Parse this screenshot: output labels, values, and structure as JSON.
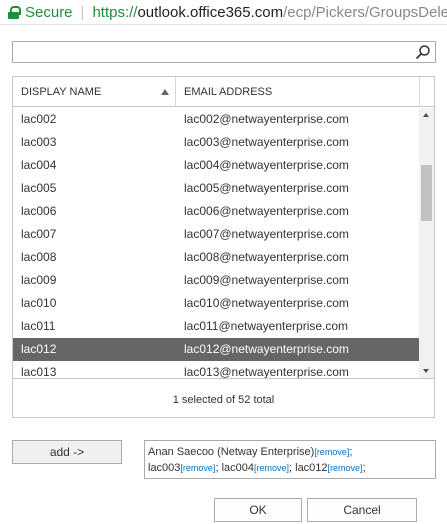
{
  "address_bar": {
    "secure_label": "Secure",
    "scheme": "https://",
    "host": "outlook.office365.com",
    "path": "/ecp/Pickers/GroupsDelega"
  },
  "search": {
    "value": "",
    "placeholder": ""
  },
  "grid": {
    "columns": [
      "DISPLAY NAME",
      "EMAIL ADDRESS"
    ],
    "sort": "DISPLAY NAME ascending",
    "rows": [
      {
        "name": "lac002",
        "email": "lac002@netwayenterprise.com",
        "selected": false
      },
      {
        "name": "lac003",
        "email": "lac003@netwayenterprise.com",
        "selected": false
      },
      {
        "name": "lac004",
        "email": "lac004@netwayenterprise.com",
        "selected": false
      },
      {
        "name": "lac005",
        "email": "lac005@netwayenterprise.com",
        "selected": false
      },
      {
        "name": "lac006",
        "email": "lac006@netwayenterprise.com",
        "selected": false
      },
      {
        "name": "lac007",
        "email": "lac007@netwayenterprise.com",
        "selected": false
      },
      {
        "name": "lac008",
        "email": "lac008@netwayenterprise.com",
        "selected": false
      },
      {
        "name": "lac009",
        "email": "lac009@netwayenterprise.com",
        "selected": false
      },
      {
        "name": "lac010",
        "email": "lac010@netwayenterprise.com",
        "selected": false
      },
      {
        "name": "lac011",
        "email": "lac011@netwayenterprise.com",
        "selected": false
      },
      {
        "name": "lac012",
        "email": "lac012@netwayenterprise.com",
        "selected": true
      },
      {
        "name": "lac013",
        "email": "lac013@netwayenterprise.com",
        "selected": false
      }
    ],
    "status": "1 selected of 52 total"
  },
  "add_button": "add ->",
  "recipients": {
    "remove_label": "[remove]",
    "items": [
      "Anan Saecoo (Netway Enterprise)",
      "lac003",
      "lac004",
      "lac012"
    ]
  },
  "buttons": {
    "ok": "OK",
    "cancel": "Cancel"
  },
  "colors": {
    "secure_green": "#1e8e3e",
    "selected_row": "#666666",
    "remove_link": "#0072c6"
  }
}
